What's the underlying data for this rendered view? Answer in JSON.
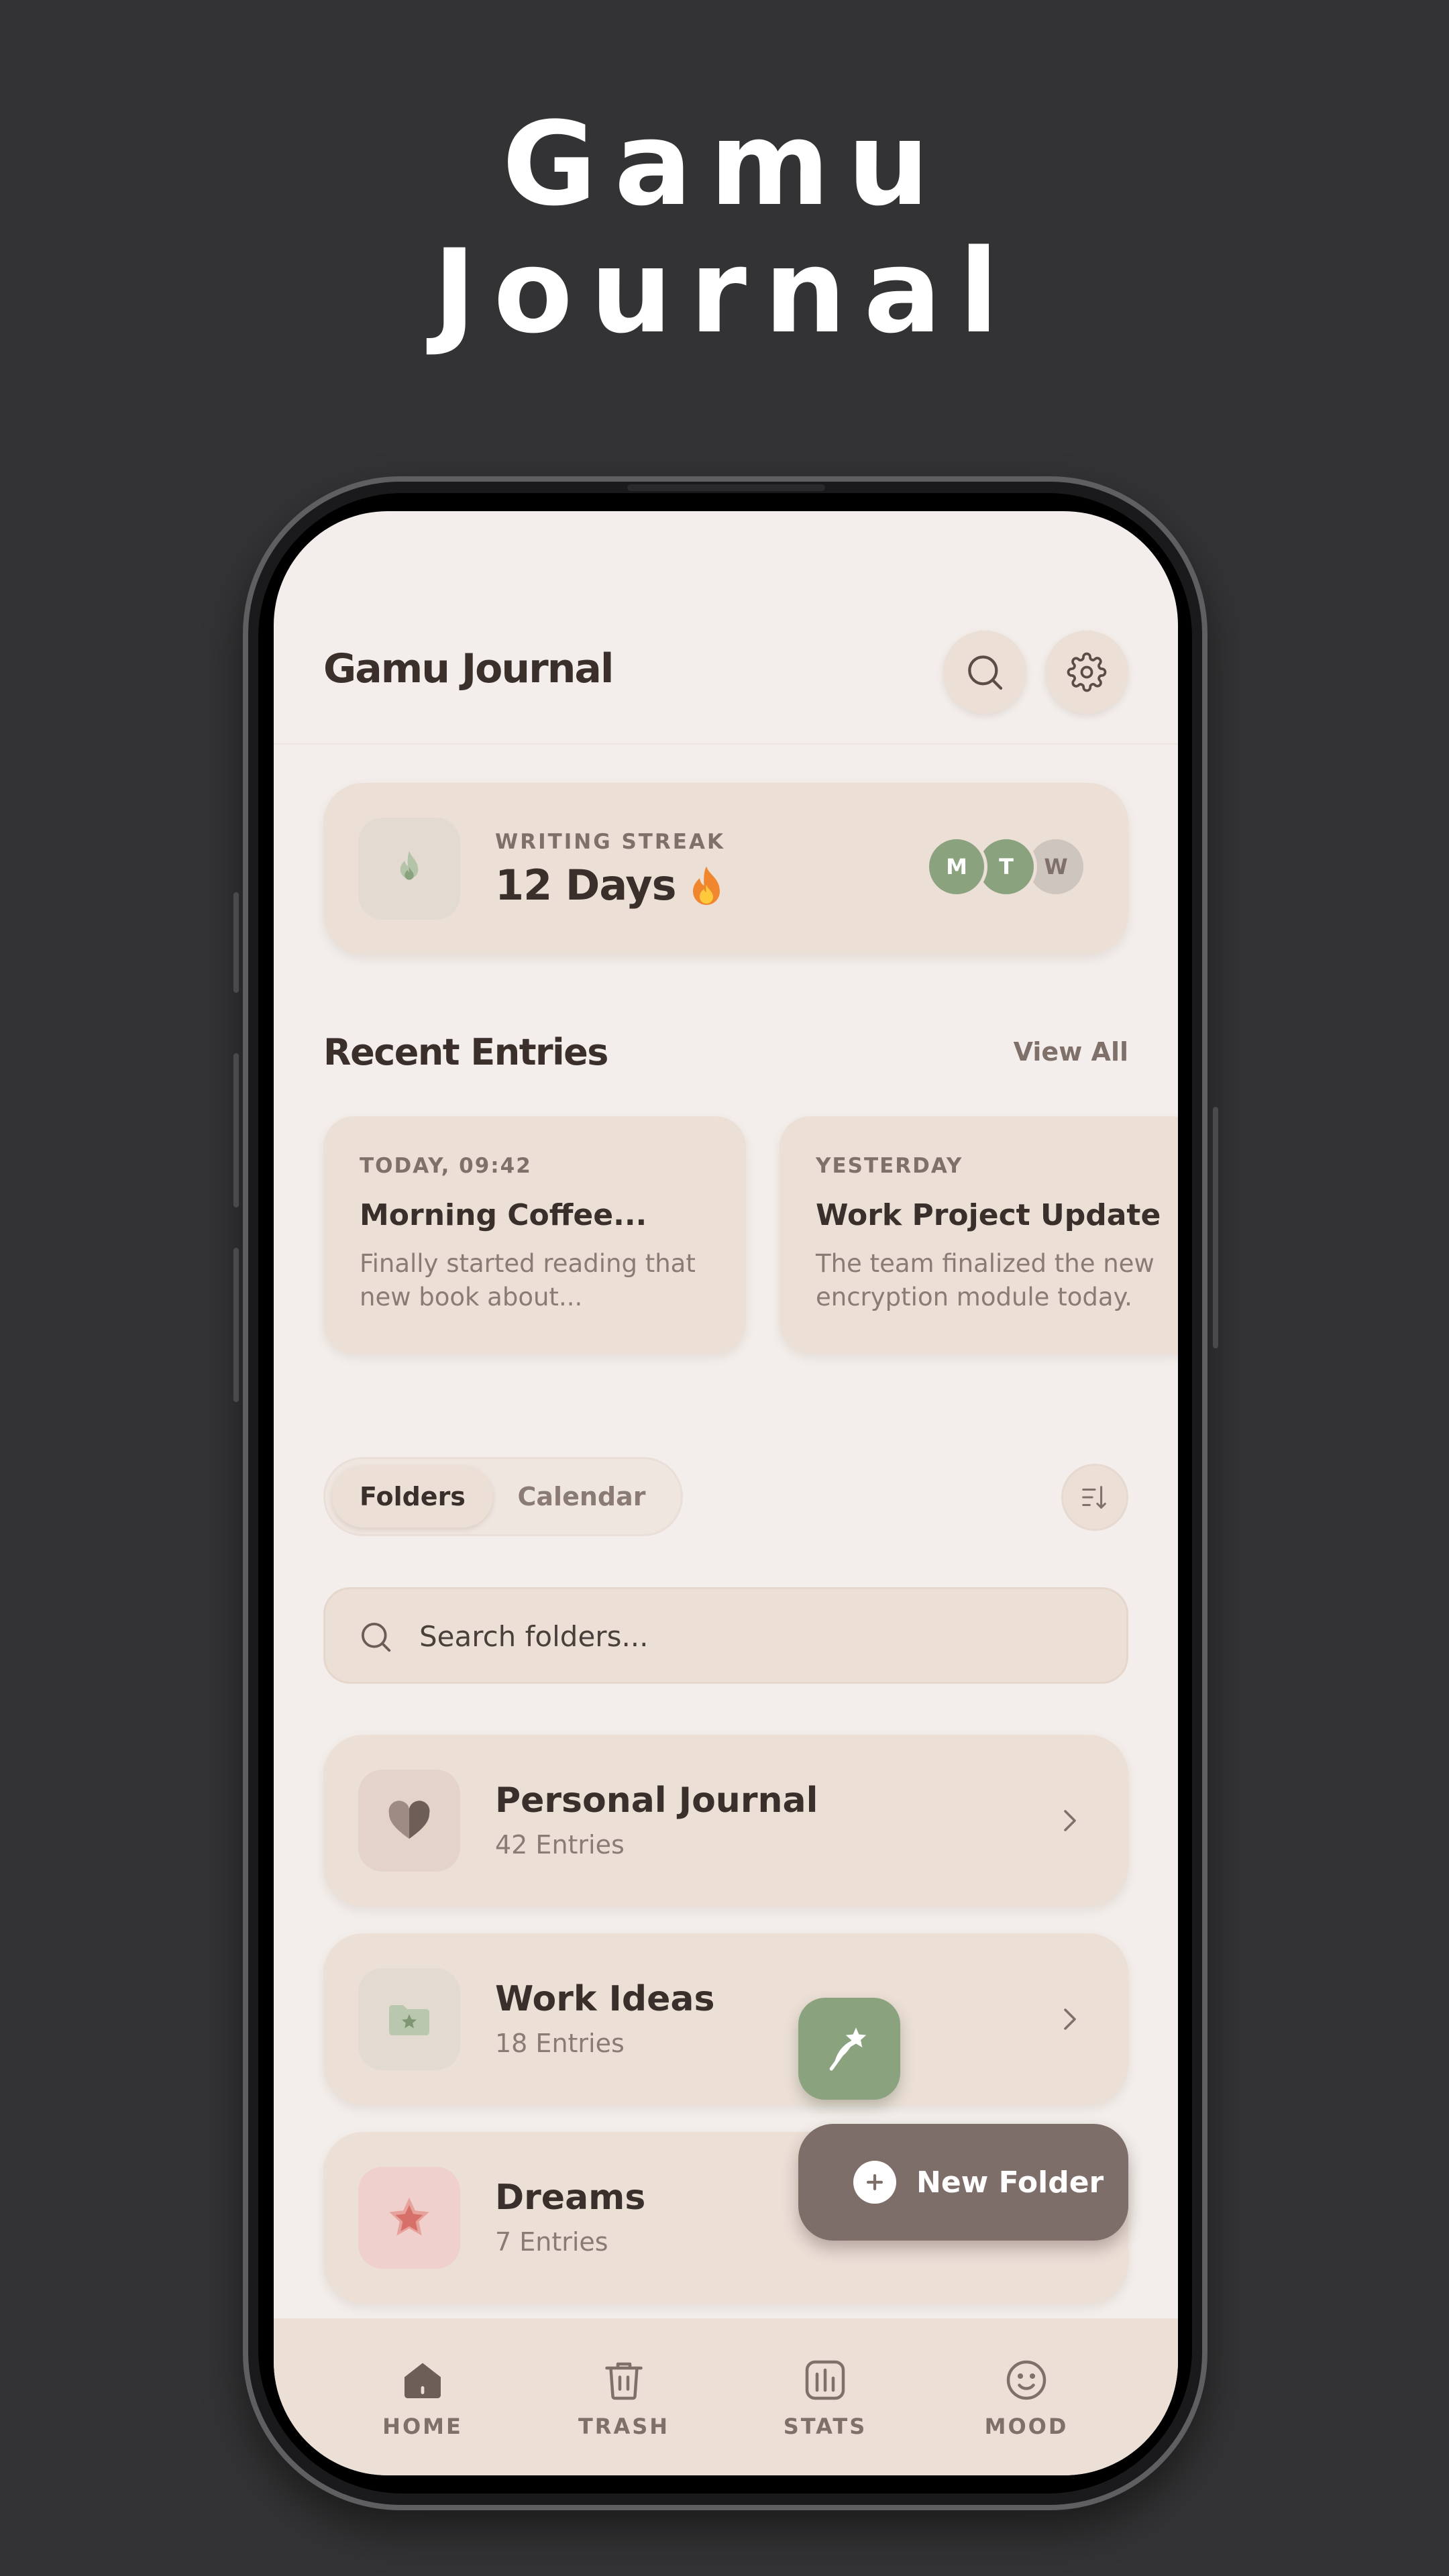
{
  "hero": {
    "line1": "Gamu",
    "line2": "Journal"
  },
  "header": {
    "title": "Gamu Journal"
  },
  "streak": {
    "label": "WRITING STREAK",
    "value": "12 Days",
    "days": [
      {
        "letter": "M",
        "color": "#8ba27f"
      },
      {
        "letter": "T",
        "color": "#8ba27f"
      },
      {
        "letter": "W",
        "color": "#cfc5bf"
      }
    ]
  },
  "recent": {
    "title": "Recent Entries",
    "view_all": "View All",
    "entries": [
      {
        "date": "TODAY, 09:42",
        "title": "Morning Coffee...",
        "preview": "Finally started reading that new book about..."
      },
      {
        "date": "YESTERDAY",
        "title": "Work Project Update",
        "preview": "The team finalized the new encryption module today."
      }
    ]
  },
  "tabs": {
    "folders": "Folders",
    "calendar": "Calendar",
    "active": "Folders"
  },
  "search": {
    "placeholder": "Search folders..."
  },
  "folders": [
    {
      "name": "Personal Journal",
      "count": "42 Entries",
      "icon": "heart-icon",
      "icon_bg": "#e3d3c9"
    },
    {
      "name": "Work Ideas",
      "count": "18 Entries",
      "icon": "folder-star-icon",
      "icon_bg": "#e3dbd2"
    },
    {
      "name": "Dreams",
      "count": "7 Entries",
      "icon": "star-icon",
      "icon_bg": "#f0d0cc"
    }
  ],
  "new_folder": {
    "label": "New Folder"
  },
  "nav": [
    {
      "label": "HOME",
      "icon": "home-icon",
      "active": true
    },
    {
      "label": "TRASH",
      "icon": "trash-icon"
    },
    {
      "label": "STATS",
      "icon": "stats-icon"
    },
    {
      "label": "MOOD",
      "icon": "mood-icon"
    }
  ],
  "colors": {
    "accent_green": "#8ba27f",
    "accent_brown": "#7d6e69",
    "card": "#ecdfd6",
    "background": "#f3eeeb"
  }
}
